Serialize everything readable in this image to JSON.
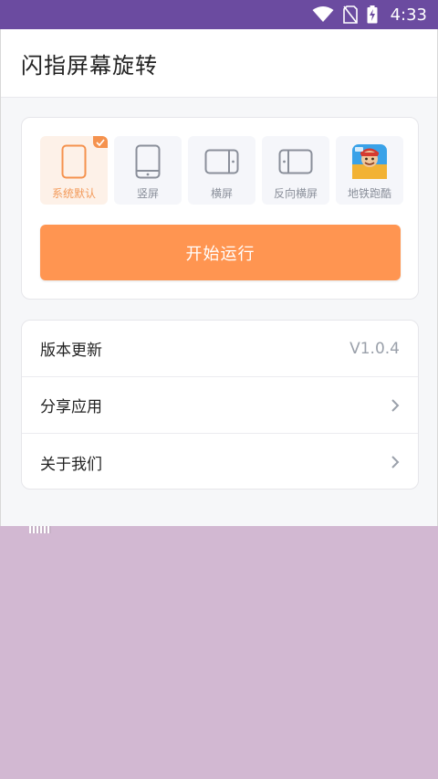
{
  "status_bar": {
    "time": "4:33",
    "background": "#6b4ba0"
  },
  "app": {
    "title": "闪指屏幕旋转",
    "accent": "#ff9551"
  },
  "modes": [
    {
      "label": "系统默认",
      "icon": "portrait-outline-icon",
      "selected": true
    },
    {
      "label": "竖屏",
      "icon": "phone-portrait-icon",
      "selected": false
    },
    {
      "label": "横屏",
      "icon": "phone-landscape-icon",
      "selected": false
    },
    {
      "label": "反向横屏",
      "icon": "phone-landscape-reverse-icon",
      "selected": false
    },
    {
      "label": "地铁跑酷",
      "icon": "subway-surfers-app-icon",
      "selected": false
    }
  ],
  "start_button": {
    "label": "开始运行"
  },
  "menu": {
    "version": {
      "label": "版本更新",
      "value": "V1.0.4"
    },
    "share": {
      "label": "分享应用",
      "icon": "chevron-right-icon"
    },
    "about": {
      "label": "关于我们",
      "icon": "chevron-right-icon"
    }
  }
}
